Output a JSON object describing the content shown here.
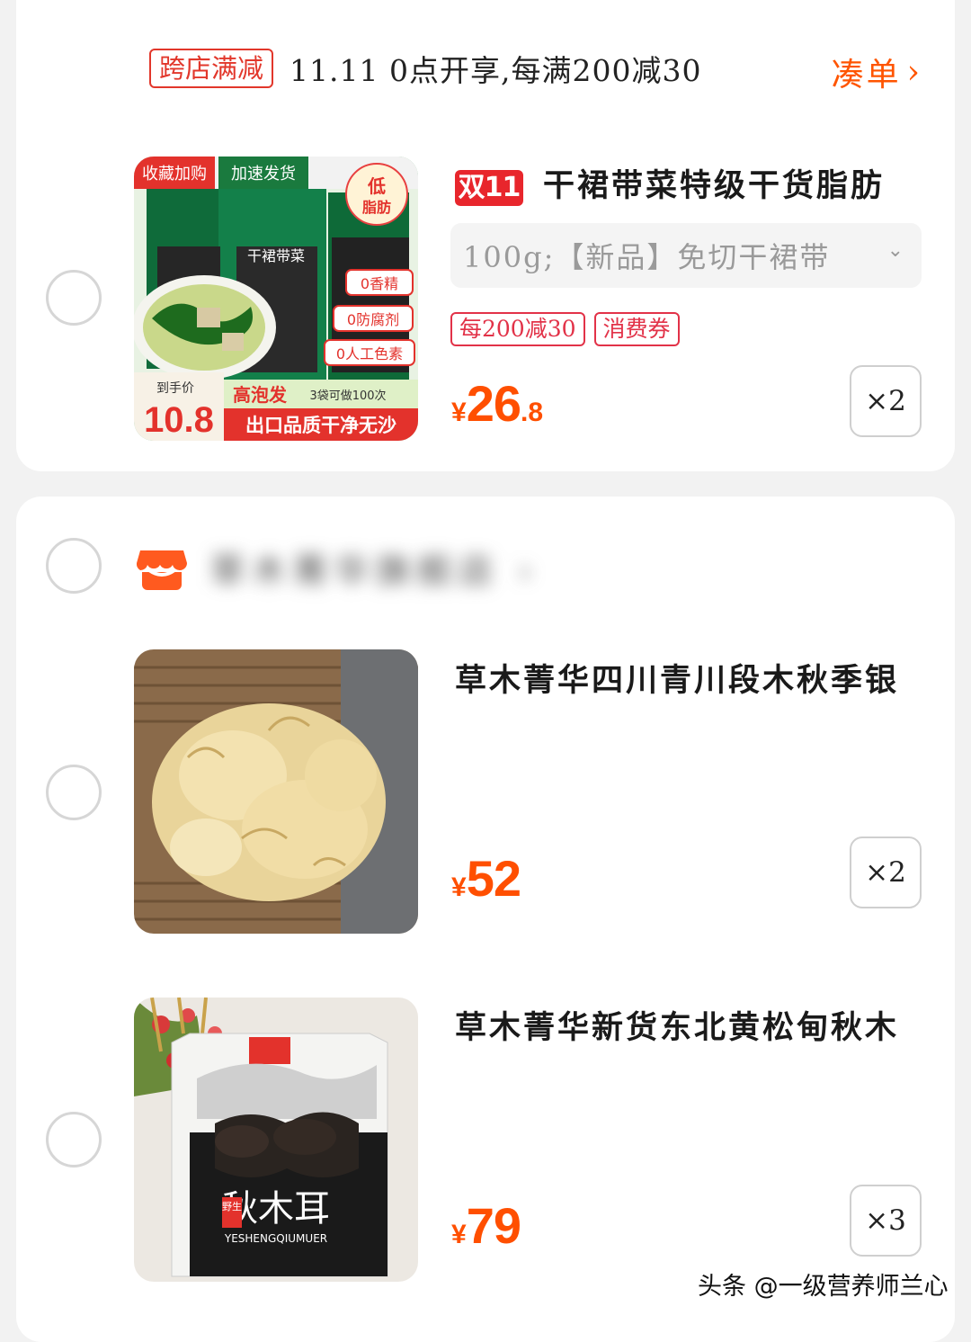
{
  "promo": {
    "tag": "跨店满减",
    "text": "11.11 0点开享,每满200减30",
    "link_label": "凑单",
    "chevron": "›"
  },
  "items": [
    {
      "badge": "双11",
      "title": "干裙带菜特级干货脂肪",
      "sku": "100g;【新品】免切干裙带",
      "sku_arrow": "⌄",
      "chips": [
        "每200减30",
        "消费券"
      ],
      "price": {
        "currency": "¥",
        "integer": "26",
        "decimal": ".8"
      },
      "quantity": "×2",
      "image_text": {
        "ribbon1": "收藏加购",
        "ribbon2": "加速发货",
        "seal_line1": "低",
        "seal_line2": "脂肪",
        "pack_label": "干裙带菜",
        "feature1": "0香精",
        "feature2": "0防腐剂",
        "feature3": "0人工色素",
        "to_hand_label": "到手价",
        "to_hand_price": "10.8",
        "banner1": "高泡发",
        "banner1_sub": "3袋可做100次",
        "banner2": "出口品质干净无沙"
      }
    },
    {
      "title": "草木菁华四川青川段木秋季银",
      "price": {
        "currency": "¥",
        "integer": "52",
        "decimal": ""
      },
      "quantity": "×2"
    },
    {
      "title": "草木菁华新货东北黄松甸秋木",
      "price": {
        "currency": "¥",
        "integer": "79",
        "decimal": ""
      },
      "quantity": "×3",
      "image_text": {
        "pack_label": "秋木耳",
        "wild_tag": "野生",
        "pinyin": "YESHENGQIUMUER"
      }
    }
  ],
  "shop": {
    "name": "草木菁华旗舰店",
    "chevron": "›"
  },
  "watermark": "头条 @一级营养师兰心",
  "colors": {
    "accent": "#ff5500",
    "price": "#ff4f00",
    "tag_red": "#e2372b"
  }
}
